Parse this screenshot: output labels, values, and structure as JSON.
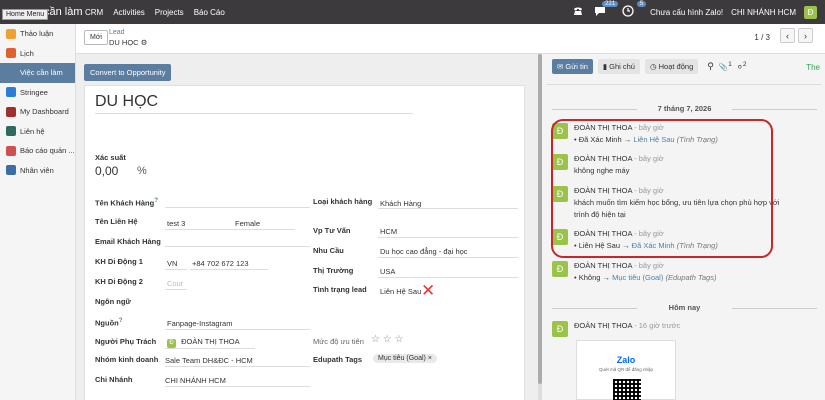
{
  "topnav": {
    "home_menu_tip": "Home Menu",
    "app_title": "cần làm",
    "menu": [
      "CRM",
      "Activities",
      "Projects",
      "Báo Cáo"
    ],
    "chat_badge": "221",
    "activity_badge": "5",
    "zalo_status": "Chưa cấu hình Zalo!",
    "branch": "CHI NHÁNH HCM",
    "user_initial": "Đ"
  },
  "sidebar": {
    "items": [
      {
        "label": "Thảo luận",
        "icon": "discuss-icon",
        "color": "#f0a030"
      },
      {
        "label": "Lịch",
        "icon": "calendar-icon",
        "color": "#e06030"
      },
      {
        "label": "Việc cần làm",
        "icon": "todo-icon",
        "color": "#5b7ea0",
        "active": true
      },
      {
        "label": "Stringee",
        "icon": "stringee-icon",
        "color": "#2a7fd4"
      },
      {
        "label": "My Dashboard",
        "icon": "dashboard-icon",
        "color": "#a03030"
      },
      {
        "label": "Liên hệ",
        "icon": "contacts-icon",
        "color": "#2e6b5e"
      },
      {
        "label": "Báo cáo quản ...",
        "icon": "report-icon",
        "color": "#d05050"
      },
      {
        "label": "Nhân viên",
        "icon": "employees-icon",
        "color": "#3a6ea5"
      }
    ]
  },
  "control": {
    "new_label": "Mới",
    "breadcrumb_parent": "Lead",
    "breadcrumb_current": "DU HỌC",
    "pager": "1 / 3"
  },
  "form": {
    "convert_label": "Convert to Opportunity",
    "name": "DU HỌC",
    "probability_label": "Xác suất",
    "probability_value": "0,00",
    "probability_unit": "%",
    "left_fields": {
      "customer_name_label": "Tên Khách Hàng",
      "contact_name_label": "Tên Liên Hệ",
      "contact_name_value": "test 3",
      "gender_value": "Female",
      "email_label": "Email Khách Hàng",
      "phone1_label": "KH Di Động 1",
      "phone1_country": "VN",
      "phone1_value": "+84 702 672 123",
      "phone2_label": "KH Di Động 2",
      "phone2_placeholder": "Cour",
      "language_label": "Ngôn ngữ",
      "source_label": "Nguồn",
      "source_value": "Fanpage-Instagram",
      "owner_label": "Người Phụ Trách",
      "owner_value": "ĐOÀN THỊ THOA",
      "team_label": "Nhóm kinh doanh",
      "team_value": "Sale Team DH&ĐC - HCM",
      "branch_label": "Chi Nhánh",
      "branch_value": "CHI NHÁNH HCM"
    },
    "right_fields": {
      "customer_type_label": "Loại khách hàng",
      "customer_type_value": "Khách Hàng",
      "advisor_label": "Vp Tư Vấn",
      "advisor_value": "HCM",
      "need_label": "Nhu Cầu",
      "need_value": "Du học cao đẳng - đại học",
      "market_label": "Thị Trường",
      "market_value": "USA",
      "lead_status_label": "Tình trạng lead",
      "lead_status_value": "Liên Hệ Sau",
      "priority_label": "Mức độ ưu tiên",
      "edupath_label": "Edupath Tags",
      "edupath_tag": "Mục tiêu (Goal)"
    }
  },
  "chatter": {
    "send_label": "Gửi tin",
    "note_label": "Ghi chú",
    "activity_label": "Hoạt động",
    "attach_count": "1",
    "follower_count": "2",
    "follow_label": "The",
    "day1": "7 tháng 7, 2026",
    "day2": "Hôm nay",
    "messages": [
      {
        "author": "ĐOÀN THỊ THOA",
        "time": "- bây giờ",
        "from": "Đã Xác Minh",
        "to": "Liên Hệ Sau",
        "field": "(Tình Trạng)"
      },
      {
        "author": "ĐOÀN THỊ THOA",
        "time": "- bây giờ",
        "text": "không nghe máy"
      },
      {
        "author": "ĐOÀN THỊ THOA",
        "time": "- bây giờ",
        "text": "khách muốn tìm kiếm học bổng, ưu tiên lựa chọn phù hợp với trình độ hiện tại"
      },
      {
        "author": "ĐOÀN THỊ THOA",
        "time": "- bây giờ",
        "from": "Liên Hệ Sau",
        "to": "Đã Xác Minh",
        "field": "(Tình Trạng)"
      },
      {
        "author": "ĐOÀN THỊ THOA",
        "time": "- bây giờ",
        "from": "Không",
        "to": "Mục tiêu (Goal)",
        "field": "(Edupath Tags)"
      },
      {
        "author": "ĐOÀN THỊ THOA",
        "time": "- 16 giờ trước"
      }
    ],
    "zalo_title": "Zalo",
    "zalo_sub": "Quét mã QR để đăng nhập"
  }
}
